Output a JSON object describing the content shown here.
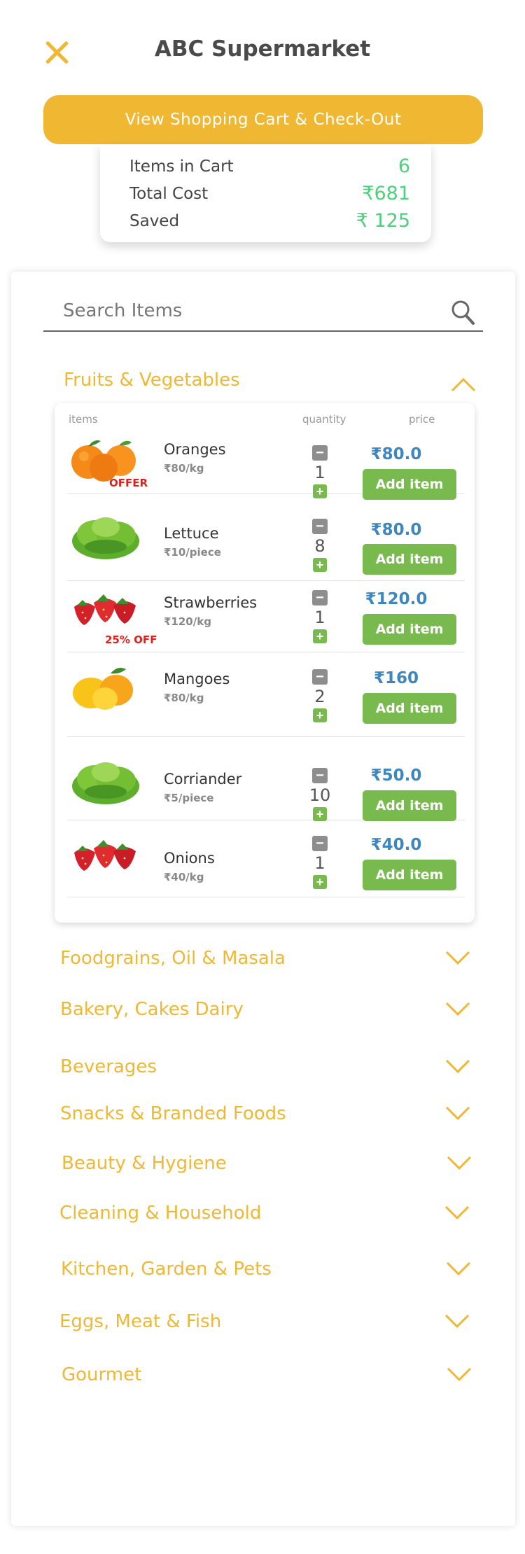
{
  "header": {
    "title": "ABC Supermarket",
    "close_icon": "close-icon"
  },
  "cart": {
    "button_label": "View Shopping Cart & Check-Out",
    "items_label": "Items in Cart",
    "items_value": "6",
    "total_label": "Total Cost",
    "total_value": "₹681",
    "saved_label": "Saved",
    "saved_value": "₹ 125"
  },
  "search": {
    "placeholder": "Search Items",
    "icon": "search-icon"
  },
  "open_category": {
    "title": "Fruits & Vegetables",
    "headers": {
      "items": "items",
      "quantity": "quantity",
      "price": "price"
    },
    "items": [
      {
        "name": "Oranges",
        "unit": "₹80/kg",
        "badge": "OFFER",
        "qty": "1",
        "price": "₹80.0",
        "add": "Add item",
        "image": "orange"
      },
      {
        "name": "Lettuce",
        "unit": "₹10/piece",
        "badge": "",
        "qty": "8",
        "price": "₹80.0",
        "add": "Add item",
        "image": "lettuce"
      },
      {
        "name": "Strawberries",
        "unit": "₹120/kg",
        "badge": "25% OFF",
        "qty": "1",
        "price": "₹120.0",
        "add": "Add item",
        "image": "strawberry"
      },
      {
        "name": "Mangoes",
        "unit": "₹80/kg",
        "badge": "",
        "qty": "2",
        "price": "₹160",
        "add": "Add item",
        "image": "mango"
      },
      {
        "name": "Corriander",
        "unit": "₹5/piece",
        "badge": "",
        "qty": "10",
        "price": "₹50.0",
        "add": "Add item",
        "image": "lettuce"
      },
      {
        "name": "Onions",
        "unit": "₹40/kg",
        "badge": "",
        "qty": "1",
        "price": "₹40.0",
        "add": "Add item",
        "image": "strawberry"
      }
    ]
  },
  "categories": [
    "Foodgrains, Oil & Masala",
    "Bakery, Cakes Dairy",
    "Beverages",
    "Snacks & Branded Foods",
    "Beauty & Hygiene",
    "Cleaning & Household",
    "Kitchen, Garden & Pets",
    "Eggs, Meat & Fish",
    "Gourmet"
  ],
  "colors": {
    "accent": "#F0B733",
    "green_value": "#4CD17B",
    "price_blue": "#3E86BE",
    "add_green": "#79BA4F",
    "offer_red": "#E0201E"
  }
}
